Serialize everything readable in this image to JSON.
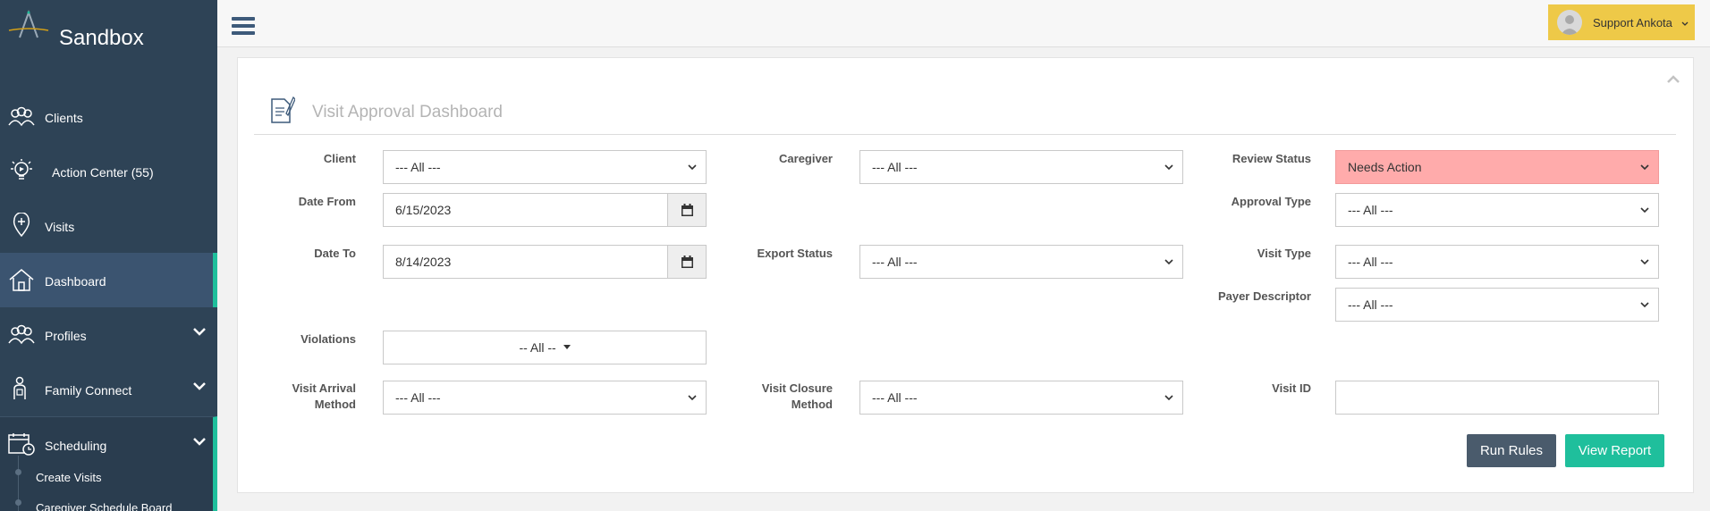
{
  "brand": {
    "title": "Sandbox"
  },
  "sidebar": {
    "items": [
      {
        "label": "Clients",
        "icon": "users-group-icon"
      },
      {
        "label": "Action Center (55)",
        "icon": "lightbulb-icon"
      },
      {
        "label": "Visits",
        "icon": "map-pin-icon"
      },
      {
        "label": "Dashboard",
        "icon": "home-icon",
        "active": true
      },
      {
        "label": "Profiles",
        "icon": "users-group-icon",
        "expandable": true
      },
      {
        "label": "Family Connect",
        "icon": "family-icon",
        "expandable": true
      },
      {
        "label": "Scheduling",
        "icon": "calendar-clock-icon",
        "expandable": true,
        "open": true
      }
    ],
    "subitems": [
      {
        "label": "Create Visits"
      },
      {
        "label": "Caregiver Schedule Board"
      }
    ]
  },
  "topbar": {
    "user_name": "Support Ankota"
  },
  "panel": {
    "title": "Visit Approval Dashboard",
    "filters": {
      "client": {
        "label": "Client",
        "value": "--- All ---"
      },
      "caregiver": {
        "label": "Caregiver",
        "value": "--- All ---"
      },
      "review_status": {
        "label": "Review Status",
        "value": "Needs Action"
      },
      "date_from": {
        "label": "Date From",
        "value": "6/15/2023"
      },
      "approval_type": {
        "label": "Approval Type",
        "value": "--- All ---"
      },
      "date_to": {
        "label": "Date To",
        "value": "8/14/2023"
      },
      "export_status": {
        "label": "Export Status",
        "value": "--- All ---"
      },
      "visit_type": {
        "label": "Visit Type",
        "value": "--- All ---"
      },
      "payer_descriptor": {
        "label": "Payer Descriptor",
        "value": "--- All ---"
      },
      "violations": {
        "label": "Violations",
        "value": "-- All --"
      },
      "visit_arrival_method": {
        "label_line1": "Visit Arrival",
        "label_line2": "Method",
        "value": "--- All ---"
      },
      "visit_closure_method": {
        "label_line1": "Visit Closure",
        "label_line2": "Method",
        "value": "--- All ---"
      },
      "visit_id": {
        "label": "Visit ID",
        "value": ""
      }
    },
    "buttons": {
      "run_rules": "Run Rules",
      "view_report": "View Report"
    }
  },
  "colors": {
    "sidebar": "#2e4356",
    "accent": "#1fbf9c",
    "user_button": "#eec948",
    "needs_action": "#ffabab",
    "run_button": "#4a5b6c"
  }
}
